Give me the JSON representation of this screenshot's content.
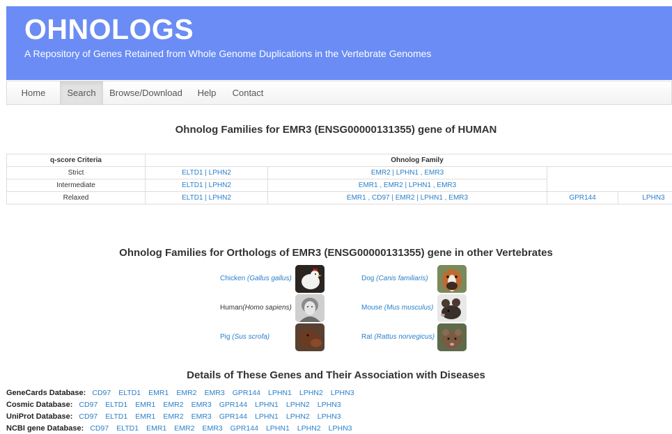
{
  "header": {
    "title": "OHNOLOGS",
    "subtitle": "A Repository of Genes Retained from Whole Genome Duplications in the Vertebrate Genomes"
  },
  "nav": [
    "Home",
    "Search",
    "Browse/Download",
    "Help",
    "Contact"
  ],
  "section1_title": "Ohnolog Families for EMR3 (ENSG00000131355) gene of HUMAN",
  "criteria_table": {
    "headers": [
      "q-score Criteria",
      "Ohnolog Family"
    ],
    "rows": [
      {
        "criteria": "Strict",
        "c1": "ELTD1 | LPHN2",
        "c2": "EMR2 | LPHN1 , EMR3",
        "c3": "",
        "c4": ""
      },
      {
        "criteria": "Intermediate",
        "c1": "ELTD1 | LPHN2",
        "c2": "EMR1 , EMR2 | LPHN1 , EMR3",
        "c3": "",
        "c4": ""
      },
      {
        "criteria": "Relaxed",
        "c1": "ELTD1 | LPHN2",
        "c2": "EMR1 , CD97 | EMR2 | LPHN1 , EMR3",
        "c3": "GPR144",
        "c4": "LPHN3"
      }
    ]
  },
  "section2_title": "Ohnolog Families for Orthologs of EMR3 (ENSG00000131355) gene in other Vertebrates",
  "species": [
    {
      "name": "Chicken ",
      "latin": "(Gallus gallus)",
      "icon": "chicken-icon"
    },
    {
      "name": "Dog ",
      "latin": "(Canis familiaris)",
      "icon": "dog-icon"
    },
    {
      "name": "Human",
      "latin": "(Homo sapiens)",
      "icon": "human-icon"
    },
    {
      "name": "Mouse ",
      "latin": "(Mus musculus)",
      "icon": "mouse-icon"
    },
    {
      "name": "Pig ",
      "latin": "(Sus scrofa)",
      "icon": "pig-icon"
    },
    {
      "name": "Rat ",
      "latin": "(Rattus norvegicus)",
      "icon": "rat-icon"
    }
  ],
  "section3_title": "Details of These Genes and Their Association with Diseases",
  "databases": [
    {
      "label": "GeneCards Database:",
      "genes": [
        "CD97",
        "ELTD1",
        "EMR1",
        "EMR2",
        "EMR3",
        "GPR144",
        "LPHN1",
        "LPHN2",
        "LPHN3"
      ]
    },
    {
      "label": "Cosmic Database:",
      "genes": [
        "CD97",
        "ELTD1",
        "EMR1",
        "EMR2",
        "EMR3",
        "GPR144",
        "LPHN1",
        "LPHN2",
        "LPHN3"
      ]
    },
    {
      "label": "UniProt Database:",
      "genes": [
        "CD97",
        "ELTD1",
        "EMR1",
        "EMR2",
        "EMR3",
        "GPR144",
        "LPHN1",
        "LPHN2",
        "LPHN3"
      ]
    },
    {
      "label": "NCBI gene Database:",
      "genes": [
        "CD97",
        "ELTD1",
        "EMR1",
        "EMR2",
        "EMR3",
        "GPR144",
        "LPHN1",
        "LPHN2",
        "LPHN3"
      ]
    }
  ]
}
